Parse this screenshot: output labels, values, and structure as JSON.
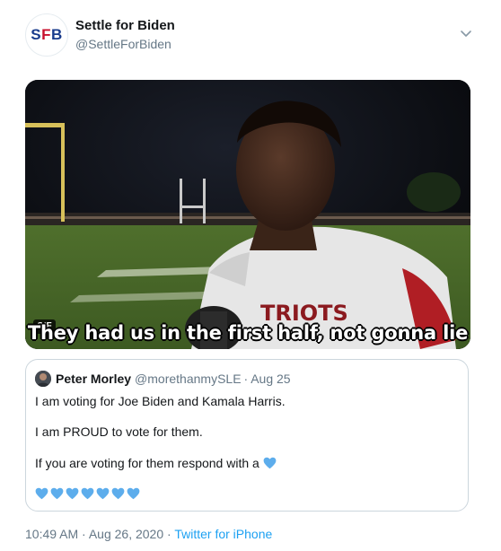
{
  "tweet": {
    "avatar_text": {
      "s": "S",
      "f": "F",
      "b": "B"
    },
    "display_name": "Settle for Biden",
    "handle": "@SettleForBiden",
    "more_icon": "chevron-down-icon"
  },
  "media": {
    "badge": "GIF",
    "subtitle": "They had us in the first half, not gonna lie",
    "jersey_text": "TRIOTS"
  },
  "quoted": {
    "name": "Peter Morley",
    "handle": "@morethanmySLE",
    "separator": "·",
    "date": "Aug 25",
    "line1": "I am voting for Joe Biden and Kamala Harris.",
    "line2": "I am PROUD to vote for them.",
    "line3": "If you are voting for them respond with a",
    "heart_icon": "blue-heart-icon",
    "heart_count": 7
  },
  "footer": {
    "timestamp": "10:49 AM · Aug 26, 2020",
    "separator": "·",
    "source": "Twitter for iPhone"
  },
  "colors": {
    "accent": "#1da1f2",
    "secondary_text": "#657786",
    "heart": "#5dadec"
  }
}
